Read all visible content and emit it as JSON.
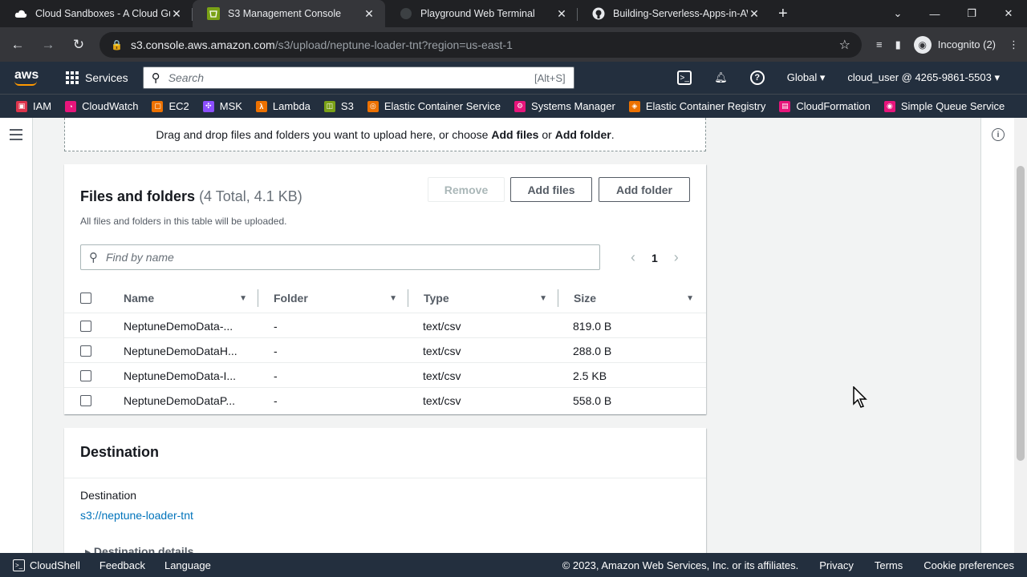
{
  "browser": {
    "tabs": [
      {
        "title": "Cloud Sandboxes - A Cloud Guru",
        "icon": "acg-icon",
        "active": false
      },
      {
        "title": "S3 Management Console",
        "icon": "s3-icon",
        "active": true
      },
      {
        "title": "Playground Web Terminal",
        "icon": "terminal-icon",
        "active": false
      },
      {
        "title": "Building-Serverless-Apps-in-AWS",
        "icon": "github-icon",
        "active": false
      }
    ],
    "url_host": "s3.console.aws.amazon.com",
    "url_path": "/s3/upload/neptune-loader-tnt?region=us-east-1",
    "incognito_label": "Incognito (2)"
  },
  "aws_header": {
    "logo": "aws",
    "services_label": "Services",
    "search_placeholder": "Search",
    "search_shortcut": "[Alt+S]",
    "region": "Global",
    "account": "cloud_user @ 4265-9861-5503"
  },
  "favorites": [
    {
      "label": "IAM",
      "color": "#dd344c"
    },
    {
      "label": "CloudWatch",
      "color": "#e7157b"
    },
    {
      "label": "EC2",
      "color": "#ed7100"
    },
    {
      "label": "MSK",
      "color": "#8c4fff"
    },
    {
      "label": "Lambda",
      "color": "#ed7100"
    },
    {
      "label": "S3",
      "color": "#7aa116"
    },
    {
      "label": "Elastic Container Service",
      "color": "#ed7100"
    },
    {
      "label": "Systems Manager",
      "color": "#e7157b"
    },
    {
      "label": "Elastic Container Registry",
      "color": "#ed7100"
    },
    {
      "label": "CloudFormation",
      "color": "#e7157b"
    },
    {
      "label": "Simple Queue Service",
      "color": "#e7157b"
    }
  ],
  "dropzone": {
    "prefix": "Drag and drop files and folders you want to upload here, or choose ",
    "add_files": "Add files",
    "or": " or ",
    "add_folder": "Add folder",
    "suffix": "."
  },
  "files_panel": {
    "title": "Files and folders",
    "count": "(4 Total, 4.1 KB)",
    "description": "All files and folders in this table will be uploaded.",
    "remove_label": "Remove",
    "add_files_label": "Add files",
    "add_folder_label": "Add folder",
    "find_placeholder": "Find by name",
    "page": "1",
    "columns": [
      "Name",
      "Folder",
      "Type",
      "Size"
    ],
    "rows": [
      {
        "name": "NeptuneDemoData-...",
        "folder": "-",
        "type": "text/csv",
        "size": "819.0 B"
      },
      {
        "name": "NeptuneDemoDataH...",
        "folder": "-",
        "type": "text/csv",
        "size": "288.0 B"
      },
      {
        "name": "NeptuneDemoData-I...",
        "folder": "-",
        "type": "text/csv",
        "size": "2.5 KB"
      },
      {
        "name": "NeptuneDemoDataP...",
        "folder": "-",
        "type": "text/csv",
        "size": "558.0 B"
      }
    ]
  },
  "destination": {
    "title": "Destination",
    "label": "Destination",
    "link": "s3://neptune-loader-tnt",
    "details": "Destination details"
  },
  "footer": {
    "cloudshell": "CloudShell",
    "feedback": "Feedback",
    "language": "Language",
    "copyright": "© 2023, Amazon Web Services, Inc. or its affiliates.",
    "privacy": "Privacy",
    "terms": "Terms",
    "cookies": "Cookie preferences"
  }
}
